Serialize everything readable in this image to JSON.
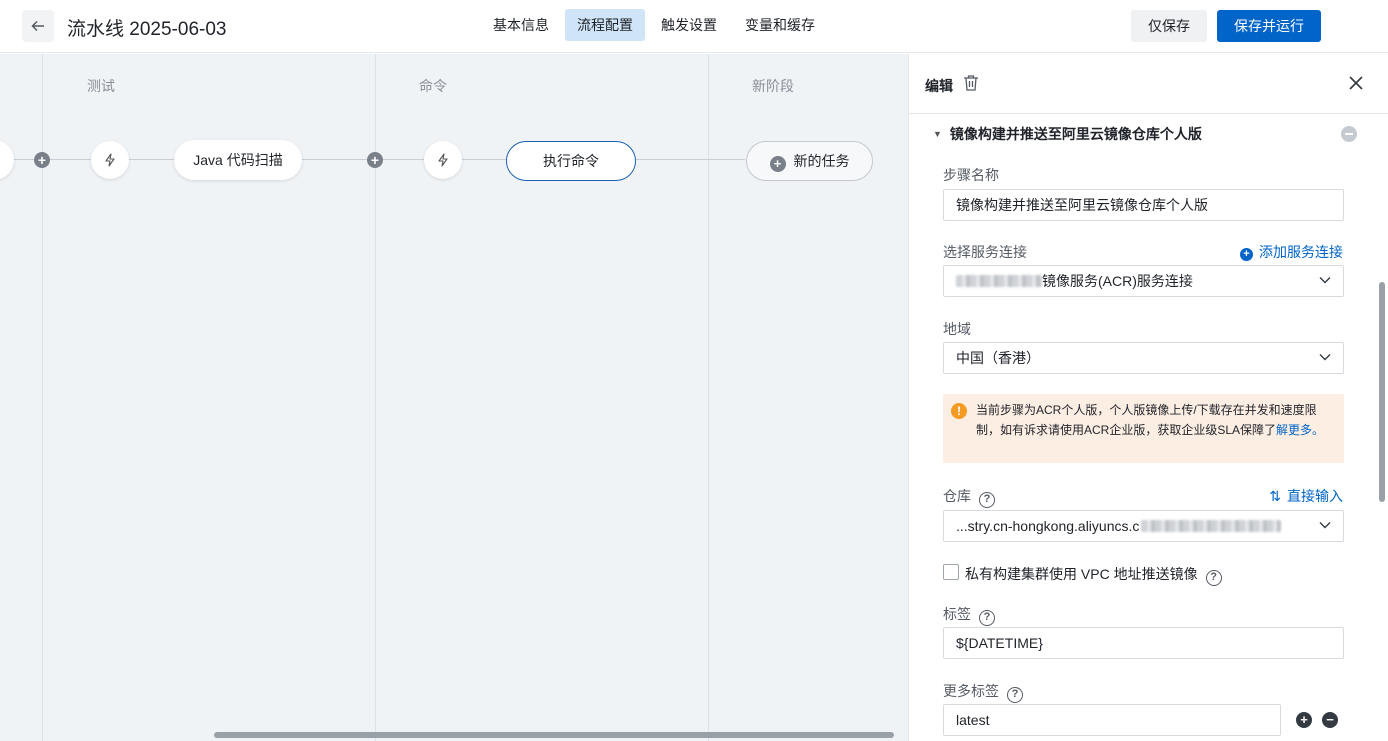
{
  "header": {
    "back_icon": "arrow-left-icon",
    "title": "流水线 2025-06-03",
    "tabs": [
      {
        "label": "基本信息",
        "active": false
      },
      {
        "label": "流程配置",
        "active": true
      },
      {
        "label": "触发设置",
        "active": false
      },
      {
        "label": "变量和缓存",
        "active": false
      }
    ],
    "save_label": "仅保存",
    "save_run_label": "保存并运行"
  },
  "pipeline": {
    "stages": [
      {
        "title": "测试",
        "job": "Java 代码扫描"
      },
      {
        "title": "命令",
        "job": "执行命令"
      },
      {
        "title": "新阶段",
        "job": "新的任务"
      }
    ]
  },
  "panel": {
    "title": "编辑",
    "section_title": "镜像构建并推送至阿里云镜像仓库个人版",
    "step_name_label": "步骤名称",
    "step_name_value": "镜像构建并推送至阿里云镜像仓库个人版",
    "service_label": "选择服务连接",
    "add_service_link": "添加服务连接",
    "service_value": "镜像服务(ACR)服务连接",
    "region_label": "地域",
    "region_value": "中国（香港）",
    "warning_text": "当前步骤为ACR个人版，个人版镜像上传/下载存在并发和速度限制，如有诉求请使用ACR企业版，获取企业级SLA保障了",
    "warning_link": "解更多。",
    "repo_label": "仓库",
    "direct_input_link": "直接输入",
    "repo_value": "...stry.cn-hongkong.aliyuncs.c",
    "vpc_label": "私有构建集群使用 VPC 地址推送镜像",
    "tag_label": "标签",
    "tag_value": "${DATETIME}",
    "more_tags_label": "更多标签",
    "more_tags_value": "latest"
  },
  "colors": {
    "primary": "#0064c8",
    "active_tab": "#cfe4f7",
    "canvas_bg": "#f0f3f6",
    "warning_bg": "#fdeee4",
    "warning_icon": "#f59a23"
  }
}
